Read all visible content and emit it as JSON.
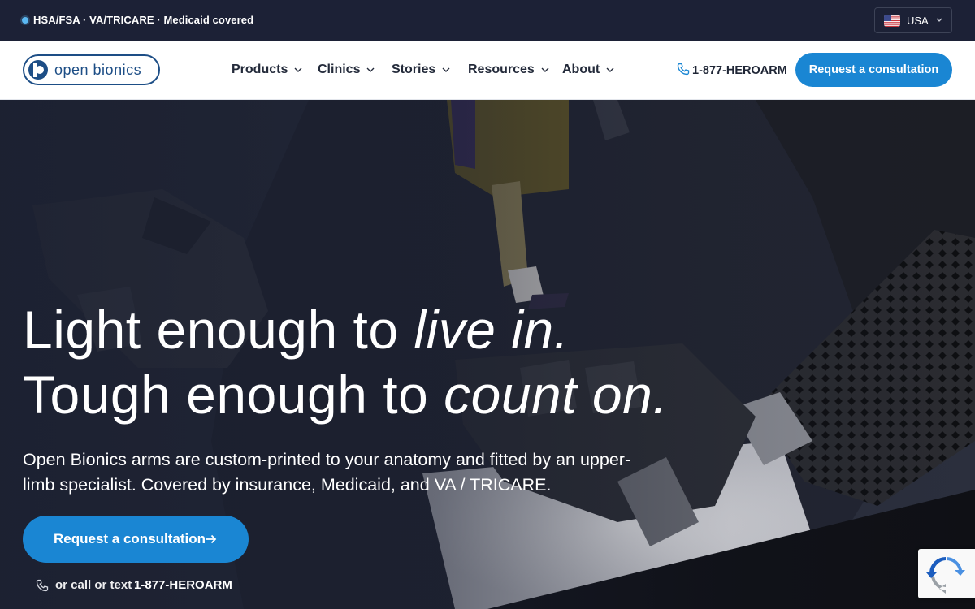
{
  "topbar": {
    "announcement": "HSA/FSA · VA/TRICARE · Medicaid covered",
    "country_label": "USA",
    "accent": "#5bb8f2"
  },
  "nav": {
    "logo_alt": "open bionics",
    "items": [
      {
        "label": "Products"
      },
      {
        "label": "Clinics"
      },
      {
        "label": "Stories"
      },
      {
        "label": "Resources"
      },
      {
        "label": "About"
      }
    ],
    "phone": "1-877-HEROARM",
    "cta": "Request a consultation",
    "brand_color": "#1a86d3"
  },
  "hero": {
    "line1_plain": "Light enough to ",
    "line1_italic": "live in.",
    "line2_plain": "Tough enough to ",
    "line2_italic": "count on.",
    "subtitle": "Open Bionics arms are custom-printed to your anatomy and fitted by an upper-limb specialist. Covered by insurance, Medicaid, and VA / TRICARE.",
    "cta": "Request a consultation",
    "call_prefix": "or call or text",
    "call_number": "1-877-HEROARM"
  },
  "icons": [
    "us-flag-icon",
    "chevron-down-icon",
    "phone-icon",
    "arrow-right-icon",
    "recaptcha-icon"
  ]
}
